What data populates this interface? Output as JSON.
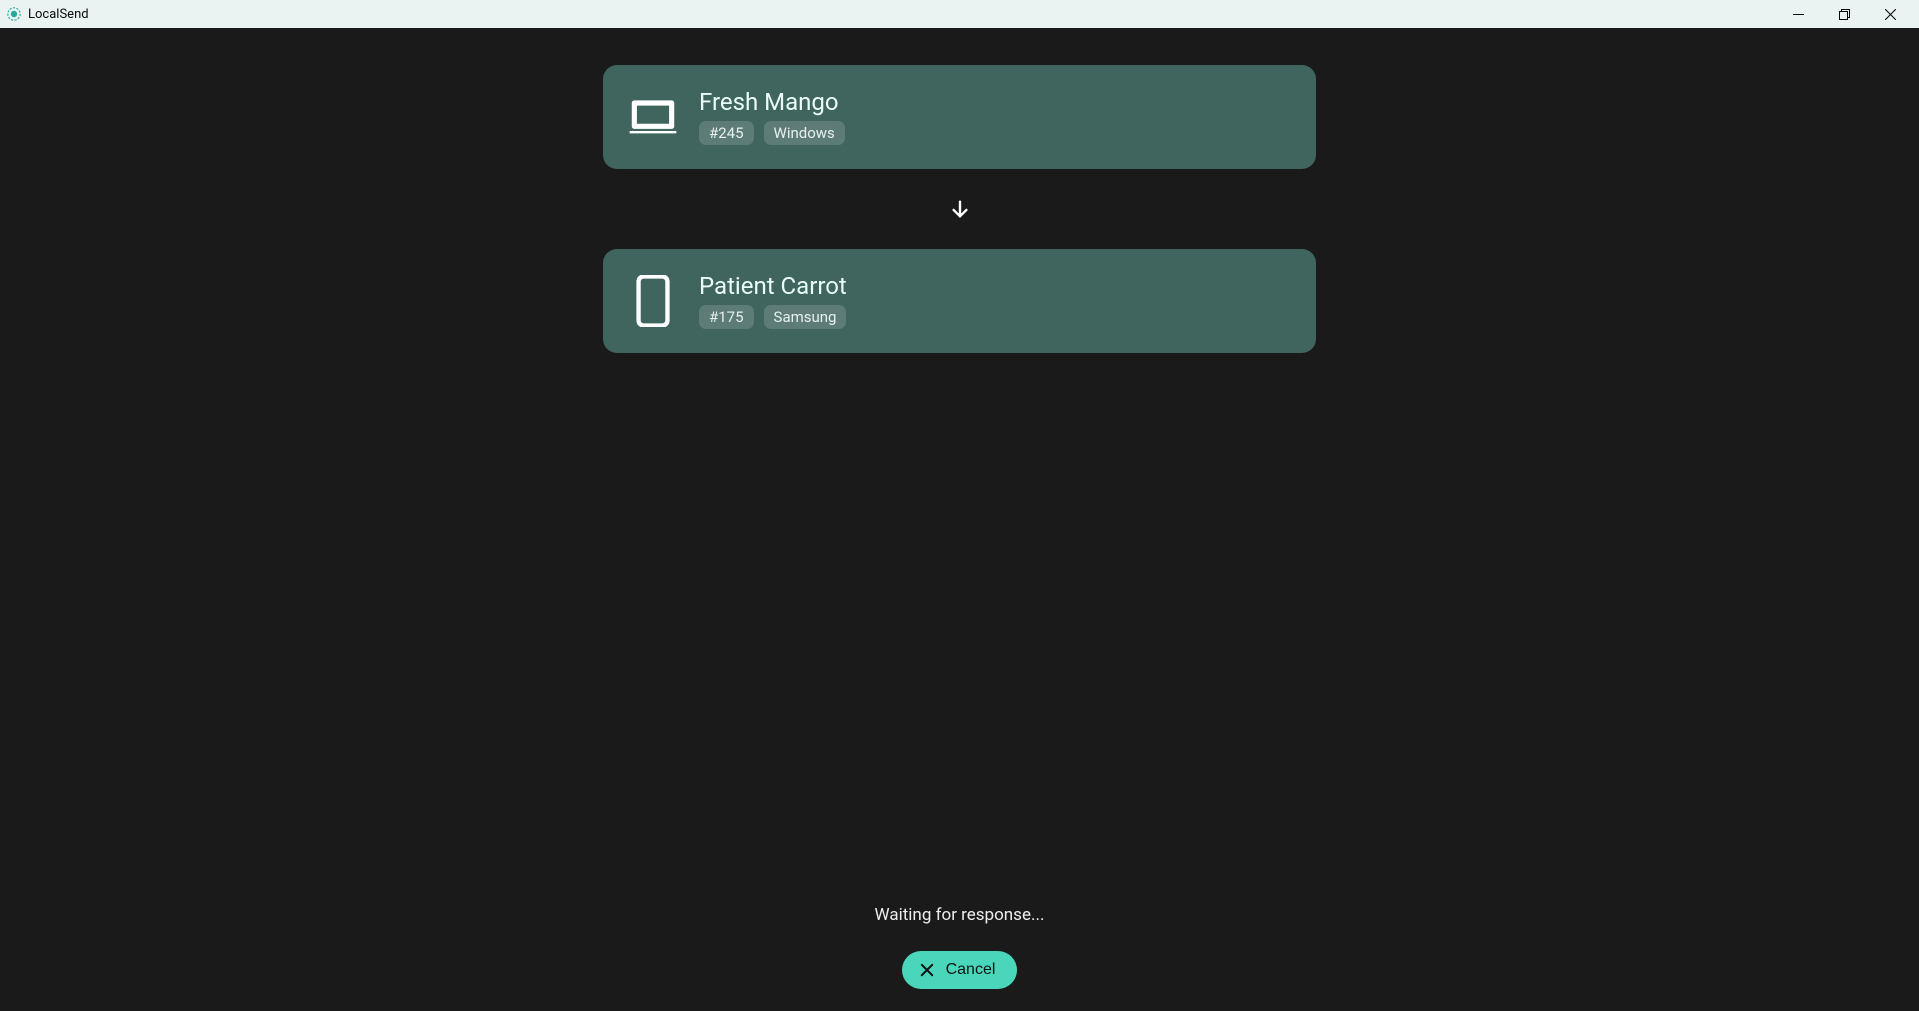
{
  "titlebar": {
    "app_title": "LocalSend"
  },
  "transfer": {
    "sender": {
      "name": "Fresh Mango",
      "id_tag": "#245",
      "platform_tag": "Windows",
      "device_type": "laptop"
    },
    "receiver": {
      "name": "Patient Carrot",
      "id_tag": "#175",
      "platform_tag": "Samsung",
      "device_type": "phone"
    }
  },
  "footer": {
    "status_text": "Waiting for response...",
    "cancel_label": "Cancel"
  },
  "colors": {
    "card_bg": "#40645e",
    "tag_bg": "#5e7c77",
    "accent": "#4ad6bb",
    "app_bg": "#1a1a1a",
    "titlebar_bg": "#eaf3f2"
  }
}
